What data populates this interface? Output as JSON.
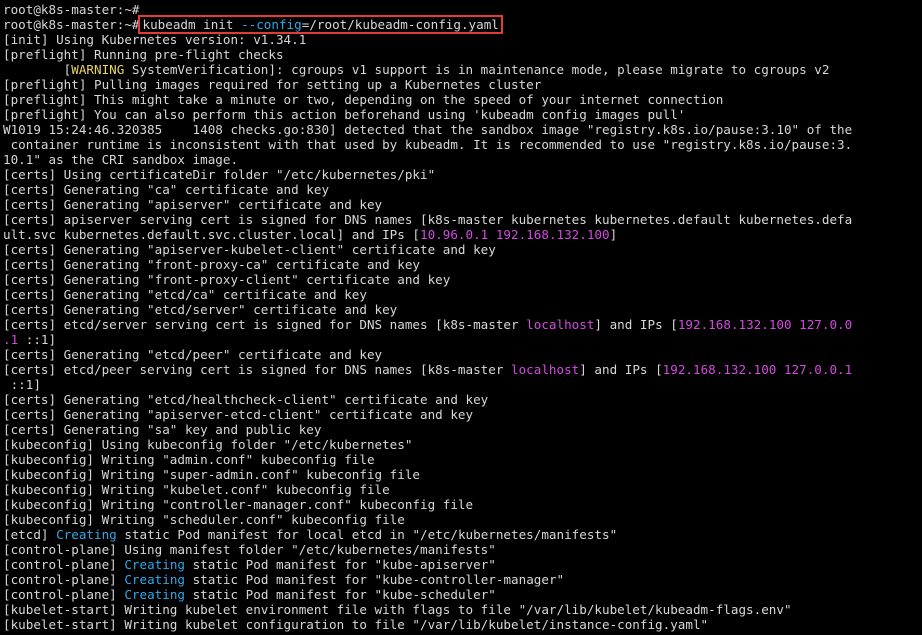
{
  "terminal": {
    "lines": [
      {
        "segs": [
          {
            "t": "root@k8s-master:~# "
          }
        ]
      },
      {
        "prompt": "root@k8s-master:~# ",
        "command": [
          {
            "t": "kubeadm init "
          },
          {
            "t": "--config",
            "c": "flag"
          },
          {
            "t": "=/root/kubeadm-config.yaml"
          }
        ]
      },
      {
        "segs": [
          {
            "t": "[init] Using Kubernetes version: v1.34.1"
          }
        ]
      },
      {
        "segs": [
          {
            "t": "[preflight] Running pre-flight checks"
          }
        ]
      },
      {
        "segs": [
          {
            "t": "        ["
          },
          {
            "t": "WARNING",
            "c": "warn"
          },
          {
            "t": " SystemVerification]: cgroups v1 support is in maintenance mode, please migrate to cgroups v2"
          }
        ]
      },
      {
        "segs": [
          {
            "t": "[preflight] Pulling images required for setting up a Kubernetes cluster"
          }
        ]
      },
      {
        "segs": [
          {
            "t": "[preflight] This might take a minute or two, depending on the speed of your internet connection"
          }
        ]
      },
      {
        "segs": [
          {
            "t": "[preflight] You can also perform this action beforehand using 'kubeadm config images pull'"
          }
        ]
      },
      {
        "segs": [
          {
            "t": "W1019 15:24:46.320385    1408 checks.go:830] detected that the sandbox image \"registry.k8s.io/pause:3.10\" of the"
          }
        ]
      },
      {
        "segs": [
          {
            "t": " container runtime is inconsistent with that used by kubeadm. It is recommended to use \"registry.k8s.io/pause:3."
          }
        ]
      },
      {
        "segs": [
          {
            "t": "10.1\" as the CRI sandbox image."
          }
        ]
      },
      {
        "segs": [
          {
            "t": "[certs] Using certificateDir folder \"/etc/kubernetes/pki\""
          }
        ]
      },
      {
        "segs": [
          {
            "t": "[certs] Generating \"ca\" certificate and key"
          }
        ]
      },
      {
        "segs": [
          {
            "t": "[certs] Generating \"apiserver\" certificate and key"
          }
        ]
      },
      {
        "segs": [
          {
            "t": "[certs] apiserver serving cert is signed for DNS names [k8s-master kubernetes kubernetes.default kubernetes.defa"
          }
        ]
      },
      {
        "segs": [
          {
            "t": "ult.svc kubernetes.default.svc.cluster.local] and IPs ["
          },
          {
            "t": "10.96.0.1 192.168.132.100",
            "c": "ip"
          },
          {
            "t": "]"
          }
        ]
      },
      {
        "segs": [
          {
            "t": "[certs] Generating \"apiserver-kubelet-client\" certificate and key"
          }
        ]
      },
      {
        "segs": [
          {
            "t": "[certs] Generating \"front-proxy-ca\" certificate and key"
          }
        ]
      },
      {
        "segs": [
          {
            "t": "[certs] Generating \"front-proxy-client\" certificate and key"
          }
        ]
      },
      {
        "segs": [
          {
            "t": "[certs] Generating \"etcd/ca\" certificate and key"
          }
        ]
      },
      {
        "segs": [
          {
            "t": "[certs] Generating \"etcd/server\" certificate and key"
          }
        ]
      },
      {
        "segs": [
          {
            "t": "[certs] etcd/server serving cert is signed for DNS names [k8s-master "
          },
          {
            "t": "localhost",
            "c": "ip"
          },
          {
            "t": "] and IPs ["
          },
          {
            "t": "192.168.132.100 127.0.0",
            "c": "ip"
          }
        ]
      },
      {
        "segs": [
          {
            "t": ".1",
            "c": "ip"
          },
          {
            "t": " ::1]"
          }
        ]
      },
      {
        "segs": [
          {
            "t": "[certs] Generating \"etcd/peer\" certificate and key"
          }
        ]
      },
      {
        "segs": [
          {
            "t": "[certs] etcd/peer serving cert is signed for DNS names [k8s-master "
          },
          {
            "t": "localhost",
            "c": "ip"
          },
          {
            "t": "] and IPs ["
          },
          {
            "t": "192.168.132.100 127.0.0.1",
            "c": "ip"
          }
        ]
      },
      {
        "segs": [
          {
            "t": " ::1]"
          }
        ]
      },
      {
        "segs": [
          {
            "t": "[certs] Generating \"etcd/healthcheck-client\" certificate and key"
          }
        ]
      },
      {
        "segs": [
          {
            "t": "[certs] Generating \"apiserver-etcd-client\" certificate and key"
          }
        ]
      },
      {
        "segs": [
          {
            "t": "[certs] Generating \"sa\" key and public key"
          }
        ]
      },
      {
        "segs": [
          {
            "t": "[kubeconfig] Using kubeconfig folder \"/etc/kubernetes\""
          }
        ]
      },
      {
        "segs": [
          {
            "t": "[kubeconfig] Writing \"admin.conf\" kubeconfig file"
          }
        ]
      },
      {
        "segs": [
          {
            "t": "[kubeconfig] Writing \"super-admin.conf\" kubeconfig file"
          }
        ]
      },
      {
        "segs": [
          {
            "t": "[kubeconfig] Writing \"kubelet.conf\" kubeconfig file"
          }
        ]
      },
      {
        "segs": [
          {
            "t": "[kubeconfig] Writing \"controller-manager.conf\" kubeconfig file"
          }
        ]
      },
      {
        "segs": [
          {
            "t": "[kubeconfig] Writing \"scheduler.conf\" kubeconfig file"
          }
        ]
      },
      {
        "segs": [
          {
            "t": "[etcd] "
          },
          {
            "t": "Creating",
            "c": "blue"
          },
          {
            "t": " static Pod manifest for local etcd in \"/etc/kubernetes/manifests\""
          }
        ]
      },
      {
        "segs": [
          {
            "t": "[control-plane] Using manifest folder \"/etc/kubernetes/manifests\""
          }
        ]
      },
      {
        "segs": [
          {
            "t": "[control-plane] "
          },
          {
            "t": "Creating",
            "c": "blue"
          },
          {
            "t": " static Pod manifest for \"kube-apiserver\""
          }
        ]
      },
      {
        "segs": [
          {
            "t": "[control-plane] "
          },
          {
            "t": "Creating",
            "c": "blue"
          },
          {
            "t": " static Pod manifest for \"kube-controller-manager\""
          }
        ]
      },
      {
        "segs": [
          {
            "t": "[control-plane] "
          },
          {
            "t": "Creating",
            "c": "blue"
          },
          {
            "t": " static Pod manifest for \"kube-scheduler\""
          }
        ]
      },
      {
        "segs": [
          {
            "t": "[kubelet-start] Writing kubelet environment file with flags to file \"/var/lib/kubelet/kubeadm-flags.env\""
          }
        ]
      },
      {
        "segs": [
          {
            "t": "[kubelet-start] Writing kubelet configuration to file \"/var/lib/kubelet/instance-config.yaml\""
          }
        ]
      }
    ]
  },
  "colors": {
    "background": "#000000",
    "foreground": "#d7d7d7",
    "warning": "#e6d65a",
    "address": "#d24be0",
    "keyword": "#2fa8e8",
    "highlight_box": "#e33a3a"
  }
}
